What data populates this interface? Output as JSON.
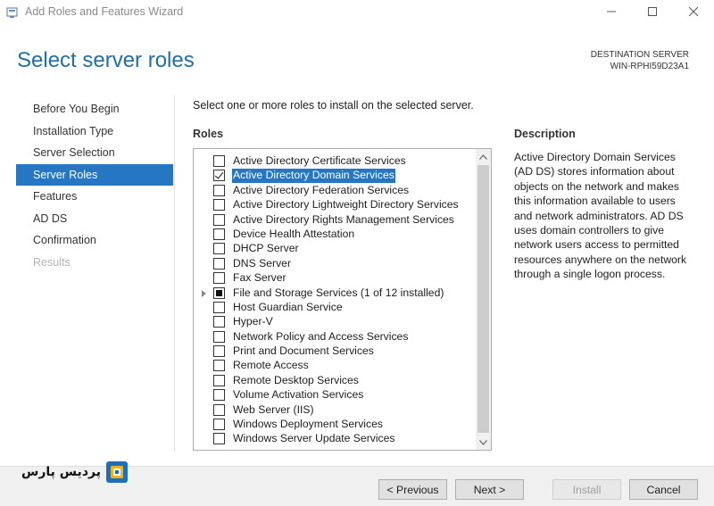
{
  "window": {
    "title": "Add Roles and Features Wizard"
  },
  "header": {
    "page_title": "Select server roles",
    "destination_label": "DESTINATION SERVER",
    "destination_server": "WIN-RPHI59D23A1"
  },
  "nav": {
    "items": [
      {
        "label": "Before You Begin",
        "state": "normal"
      },
      {
        "label": "Installation Type",
        "state": "normal"
      },
      {
        "label": "Server Selection",
        "state": "normal"
      },
      {
        "label": "Server Roles",
        "state": "active"
      },
      {
        "label": "Features",
        "state": "normal"
      },
      {
        "label": "AD DS",
        "state": "normal"
      },
      {
        "label": "Confirmation",
        "state": "normal"
      },
      {
        "label": "Results",
        "state": "disabled"
      }
    ]
  },
  "main": {
    "instruction": "Select one or more roles to install on the selected server.",
    "roles_heading": "Roles",
    "roles": [
      {
        "label": "Active Directory Certificate Services",
        "check": "none"
      },
      {
        "label": "Active Directory Domain Services",
        "check": "checked",
        "selected": true
      },
      {
        "label": "Active Directory Federation Services",
        "check": "none"
      },
      {
        "label": "Active Directory Lightweight Directory Services",
        "check": "none"
      },
      {
        "label": "Active Directory Rights Management Services",
        "check": "none"
      },
      {
        "label": "Device Health Attestation",
        "check": "none"
      },
      {
        "label": "DHCP Server",
        "check": "none"
      },
      {
        "label": "DNS Server",
        "check": "none"
      },
      {
        "label": "Fax Server",
        "check": "none"
      },
      {
        "label": "File and Storage Services (1 of 12 installed)",
        "check": "partial",
        "expandable": true
      },
      {
        "label": "Host Guardian Service",
        "check": "none"
      },
      {
        "label": "Hyper-V",
        "check": "none"
      },
      {
        "label": "Network Policy and Access Services",
        "check": "none"
      },
      {
        "label": "Print and Document Services",
        "check": "none"
      },
      {
        "label": "Remote Access",
        "check": "none"
      },
      {
        "label": "Remote Desktop Services",
        "check": "none"
      },
      {
        "label": "Volume Activation Services",
        "check": "none"
      },
      {
        "label": "Web Server (IIS)",
        "check": "none"
      },
      {
        "label": "Windows Deployment Services",
        "check": "none"
      },
      {
        "label": "Windows Server Update Services",
        "check": "none"
      }
    ],
    "description_heading": "Description",
    "description_text": "Active Directory Domain Services (AD DS) stores information about objects on the network and makes this information available to users and network administrators. AD DS uses domain controllers to give network users access to permitted resources anywhere on the network through a single logon process."
  },
  "footer": {
    "previous_label": "< Previous",
    "next_label": "Next >",
    "install_label": "Install",
    "cancel_label": "Cancel",
    "logo_text": "پردیس پارس"
  },
  "colors": {
    "accent": "#2577c4",
    "title_blue": "#1f6fa5",
    "logo_blue": "#1c6fb8",
    "logo_yellow": "#f2b21c"
  }
}
